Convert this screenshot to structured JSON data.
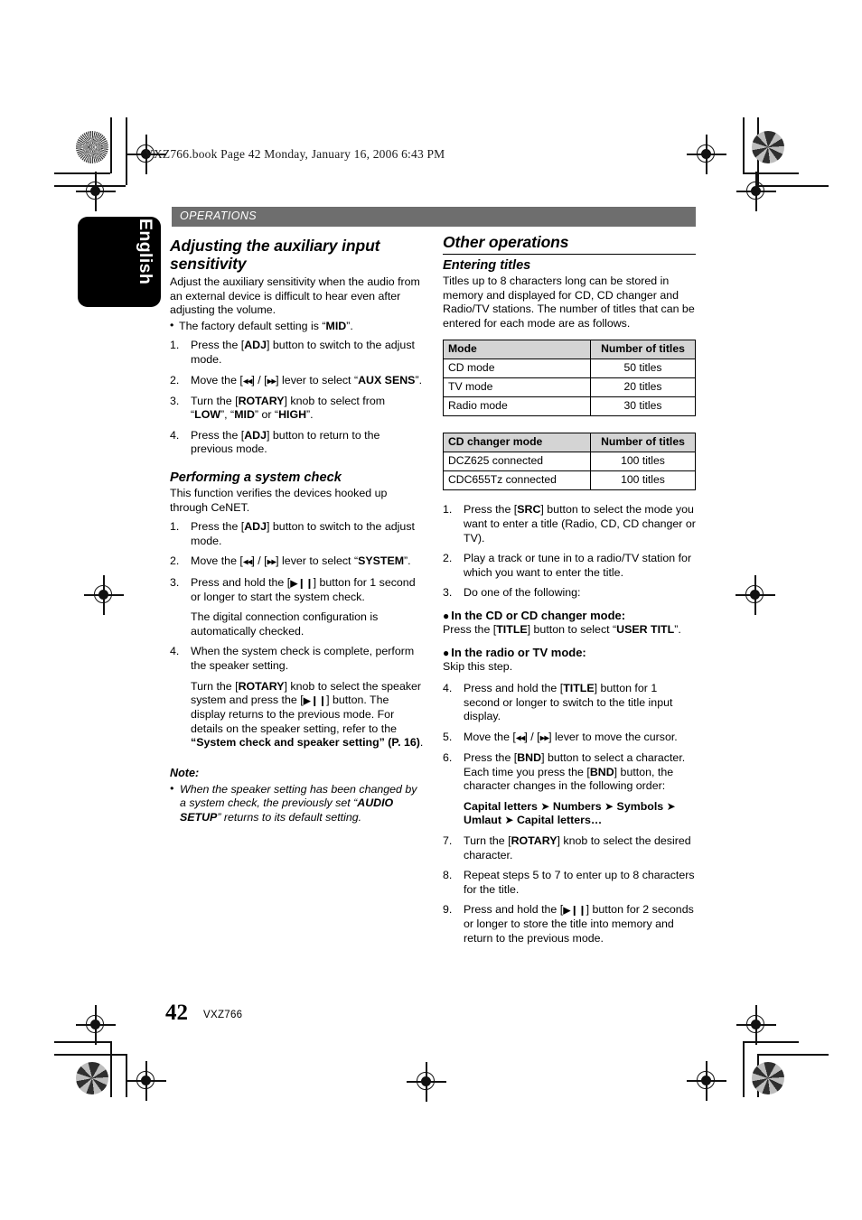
{
  "meta": {
    "slug": "VXZ766.book  Page 42  Monday, January 16, 2006  6:43 PM",
    "banner": "OPERATIONS",
    "language_tab": "English",
    "folio": "42",
    "model": "VXZ766"
  },
  "left_column": {
    "section1": {
      "heading": "Adjusting the auxiliary input sensitivity",
      "intro": "Adjust the auxiliary sensitivity when the audio from an external device is difficult to hear even after adjusting the volume.",
      "bullets": [
        "The factory default setting is “MID”."
      ],
      "steps": [
        {
          "num": "1.",
          "text": "Press the [ADJ] button to switch to the adjust mode."
        },
        {
          "num": "2.",
          "text": "Move the [◀◀] / [▶▶] lever to select “AUX SENS”."
        },
        {
          "num": "3.",
          "text": "Turn the [ROTARY] knob to select from “LOW”, “MID” or “HIGH”."
        },
        {
          "num": "4.",
          "text": "Press the [ADJ] button to return to the previous mode."
        }
      ]
    },
    "section2": {
      "heading": "Performing a system check",
      "intro": "This function verifies the devices hooked up through CeNET.",
      "steps": [
        {
          "num": "1.",
          "text": "Press the [ADJ] button to switch to the adjust mode."
        },
        {
          "num": "2.",
          "text": "Move the [◀◀] / [▶▶] lever to select “SYSTEM”."
        },
        {
          "num": "3.",
          "text": "Press and hold the [▶❙❙] button for 1 second or longer to start the system check.",
          "cont": "The digital connection configuration is automatically checked."
        },
        {
          "num": "4.",
          "text": "When the system check is complete, perform the speaker setting.",
          "cont": "Turn the [ROTARY] knob to select the speaker system and press the [▶❙❙] button. The display returns to the previous mode. For details on the speaker setting, refer to the “System check and speaker setting” (P. 16)."
        }
      ],
      "note": {
        "heading": "Note:",
        "items": [
          "When the speaker setting has been changed by a system check, the previously set “AUDIO SETUP” returns to its default setting."
        ]
      }
    }
  },
  "right_column": {
    "heading": "Other operations",
    "subheading": "Entering titles",
    "intro": "Titles up to 8 characters long can be stored in memory and displayed for CD, CD changer and Radio/TV stations. The number of titles that can be entered for each mode are as follows.",
    "table1": {
      "headers": [
        "Mode",
        "Number of titles"
      ],
      "rows": [
        [
          "CD mode",
          "50 titles"
        ],
        [
          "TV mode",
          "20 titles"
        ],
        [
          "Radio mode",
          "30 titles"
        ]
      ]
    },
    "table2": {
      "headers": [
        "CD changer mode",
        "Number of titles"
      ],
      "rows": [
        [
          "DCZ625 connected",
          "100 titles"
        ],
        [
          "CDC655Tz connected",
          "100 titles"
        ]
      ]
    },
    "steps_a": [
      {
        "num": "1.",
        "text": "Press the [SRC] button to select the mode you want to enter a title (Radio, CD, CD changer or TV)."
      },
      {
        "num": "2.",
        "text": "Play a track or tune in to a radio/TV station for which you want to enter the title."
      },
      {
        "num": "3.",
        "text": "Do one of the following:"
      }
    ],
    "mode_blocks": [
      {
        "title": "In the CD or CD changer mode:",
        "body": "Press the [TITLE] button to select “USER TITL”."
      },
      {
        "title": "In the radio or TV mode:",
        "body": "Skip this step."
      }
    ],
    "steps_b": [
      {
        "num": "4.",
        "text": "Press and hold the [TITLE] button for 1 second or longer to switch to the title input display."
      },
      {
        "num": "5.",
        "text": "Move the [◀◀] / [▶▶] lever to move the cursor."
      },
      {
        "num": "6.",
        "text": "Press the [BND] button to select a character. Each time you press the [BND] button, the character changes in the following order:",
        "cont": "Capital letters ➔ Numbers ➔ Symbols ➔ Umlaut ➔ Capital letters…"
      },
      {
        "num": "7.",
        "text": "Turn the [ROTARY] knob to select the desired character."
      },
      {
        "num": "8.",
        "text": "Repeat steps 5 to 7 to enter up to 8 characters for the title."
      },
      {
        "num": "9.",
        "text": "Press and hold the [▶❙❙] button for 2 seconds or longer to store the title into memory and return to the previous mode."
      }
    ]
  },
  "colors": {
    "banner_gray": "#6e6e6e",
    "table_header_gray": "#d4d4d4",
    "tab_black": "#000000"
  }
}
